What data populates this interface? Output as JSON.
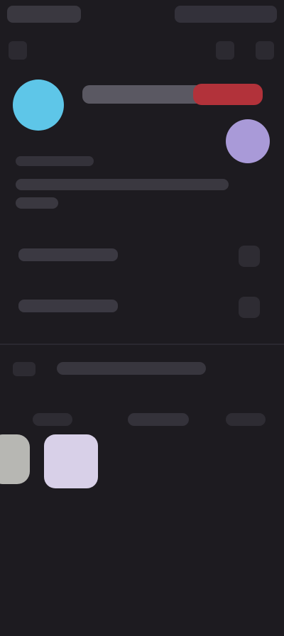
{
  "colors": {
    "background": "#1d1b20",
    "avatar": "#5ec6e8",
    "badge": "#b2323a",
    "secondary_avatar": "#a99ad8",
    "gallery_thumb_1": "#b7b7b3",
    "gallery_thumb_2": "#d8d0e8"
  },
  "icons": {
    "back": "arrow-left-icon",
    "notifications": "bell-icon",
    "more": "more-vert-icon",
    "chevron": "chevron-right-icon",
    "link": "link-icon"
  }
}
